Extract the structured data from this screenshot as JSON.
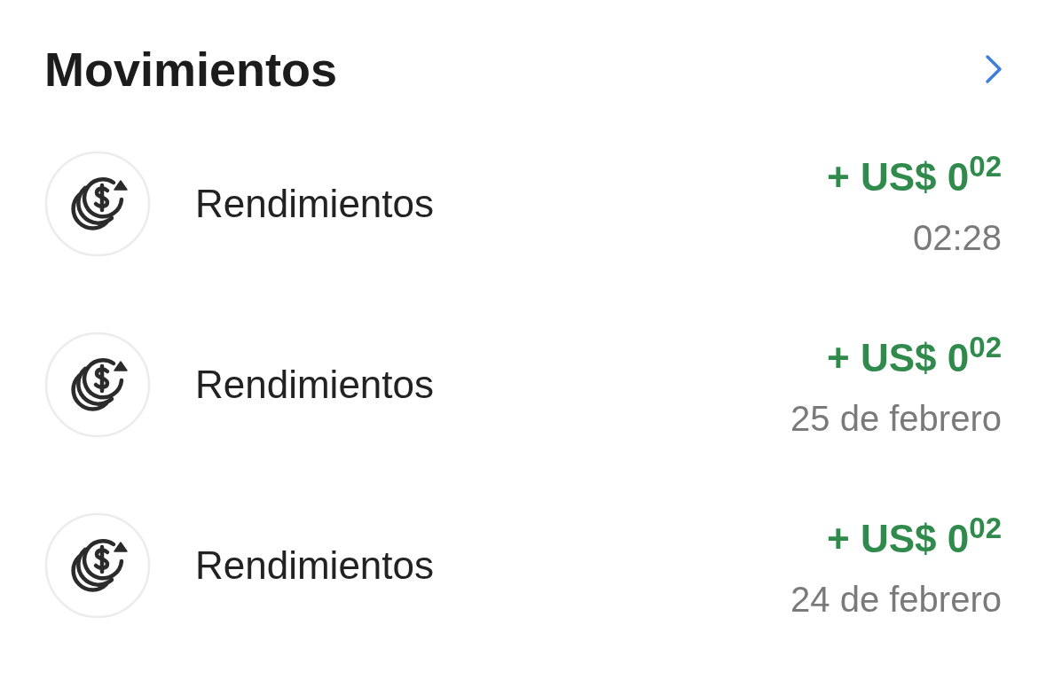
{
  "header": {
    "title": "Movimientos"
  },
  "movements": [
    {
      "name": "Rendimientos",
      "amount": "+ US$ 0$^{02}$",
      "date": "02:28"
    },
    {
      "name": "Rendimientos",
      "amount": "+ US$ 0$^{02}$",
      "date": "25 de febrero"
    },
    {
      "name": "Rendimientos",
      "amount": "+ US$ 0$^{02}$",
      "date": "24 de febrero"
    }
  ]
}
